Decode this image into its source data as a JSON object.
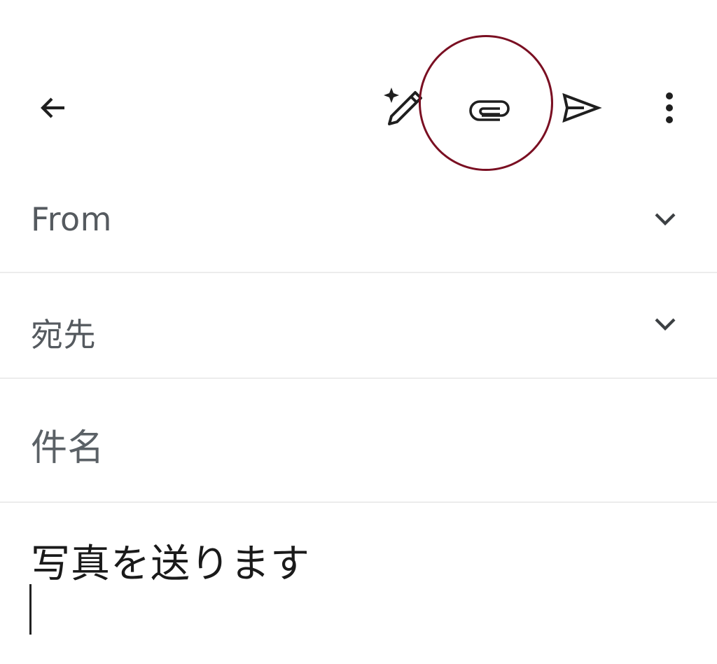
{
  "toolbar": {
    "back_icon": "arrow-left-icon",
    "assist_icon": "magic-pen-icon",
    "attach_icon": "paperclip-icon",
    "send_icon": "send-icon",
    "more_icon": "more-vertical-icon",
    "highlight_color": "#7a0f22"
  },
  "fields": {
    "from_label": "From",
    "to_label": "宛先",
    "subject_placeholder": "件名"
  },
  "body": {
    "text": "写真を送ります"
  },
  "colors": {
    "background": "#ffffff",
    "label": "#555a5f",
    "divider": "#ececec",
    "text": "#1a1a1a"
  }
}
